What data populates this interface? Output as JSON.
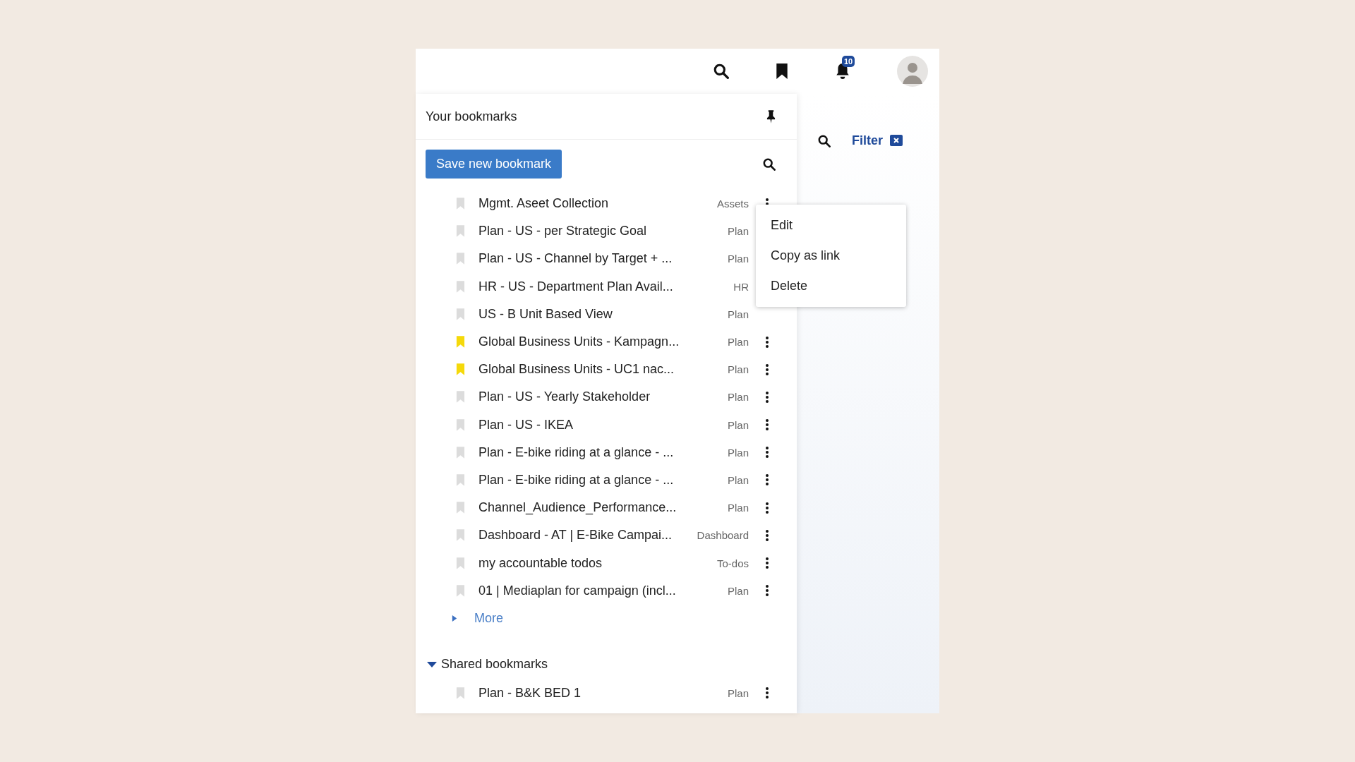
{
  "header": {
    "notification_count": "10"
  },
  "panel": {
    "title": "Your bookmarks",
    "save_button": "Save new bookmark"
  },
  "bookmarks": [
    {
      "name": "Mgmt. Aseet Collection",
      "type": "Assets",
      "highlighted": false,
      "menu_open": true
    },
    {
      "name": "Plan - US - per Strategic Goal",
      "type": "Plan",
      "highlighted": false,
      "menu_open": false,
      "more_button_visible": false
    },
    {
      "name": "Plan - US - Channel by Target + ...",
      "type": "Plan",
      "highlighted": false,
      "menu_open": false,
      "more_button_visible": false
    },
    {
      "name": "HR - US - Department Plan Avail...",
      "type": "HR",
      "highlighted": false,
      "menu_open": false,
      "more_button_visible": false
    },
    {
      "name": "US - B Unit Based View",
      "type": "Plan",
      "highlighted": false,
      "menu_open": false,
      "more_button_visible": false
    },
    {
      "name": "Global Business Units - Kampagn...",
      "type": "Plan",
      "highlighted": true,
      "menu_open": false
    },
    {
      "name": "Global Business Units - UC1 nac...",
      "type": "Plan",
      "highlighted": true,
      "menu_open": false
    },
    {
      "name": "Plan - US - Yearly Stakeholder",
      "type": "Plan",
      "highlighted": false,
      "menu_open": false
    },
    {
      "name": "Plan - US - IKEA",
      "type": "Plan",
      "highlighted": false,
      "menu_open": false
    },
    {
      "name": "Plan - E-bike riding at a glance - ...",
      "type": "Plan",
      "highlighted": false,
      "menu_open": false
    },
    {
      "name": "Plan - E-bike riding at a glance - ...",
      "type": "Plan",
      "highlighted": false,
      "menu_open": false
    },
    {
      "name": "Channel_Audience_Performance...",
      "type": "Plan",
      "highlighted": false,
      "menu_open": false
    },
    {
      "name": "Dashboard - AT | E-Bike Campai...",
      "type": "Dashboard",
      "highlighted": false,
      "menu_open": false
    },
    {
      "name": "my accountable todos",
      "type": "To-dos",
      "highlighted": false,
      "menu_open": false
    },
    {
      "name": "01 | Mediaplan for campaign (incl...",
      "type": "Plan",
      "highlighted": false,
      "menu_open": false
    }
  ],
  "more": {
    "label": "More",
    "expanded": false
  },
  "context_menu": [
    "Edit",
    "Copy as link",
    "Delete"
  ],
  "shared": {
    "title": "Shared bookmarks",
    "expanded": true,
    "bookmarks": [
      {
        "name": "Plan - B&K BED 1",
        "type": "Plan",
        "highlighted": false
      }
    ]
  },
  "filter": {
    "label": "Filter"
  }
}
